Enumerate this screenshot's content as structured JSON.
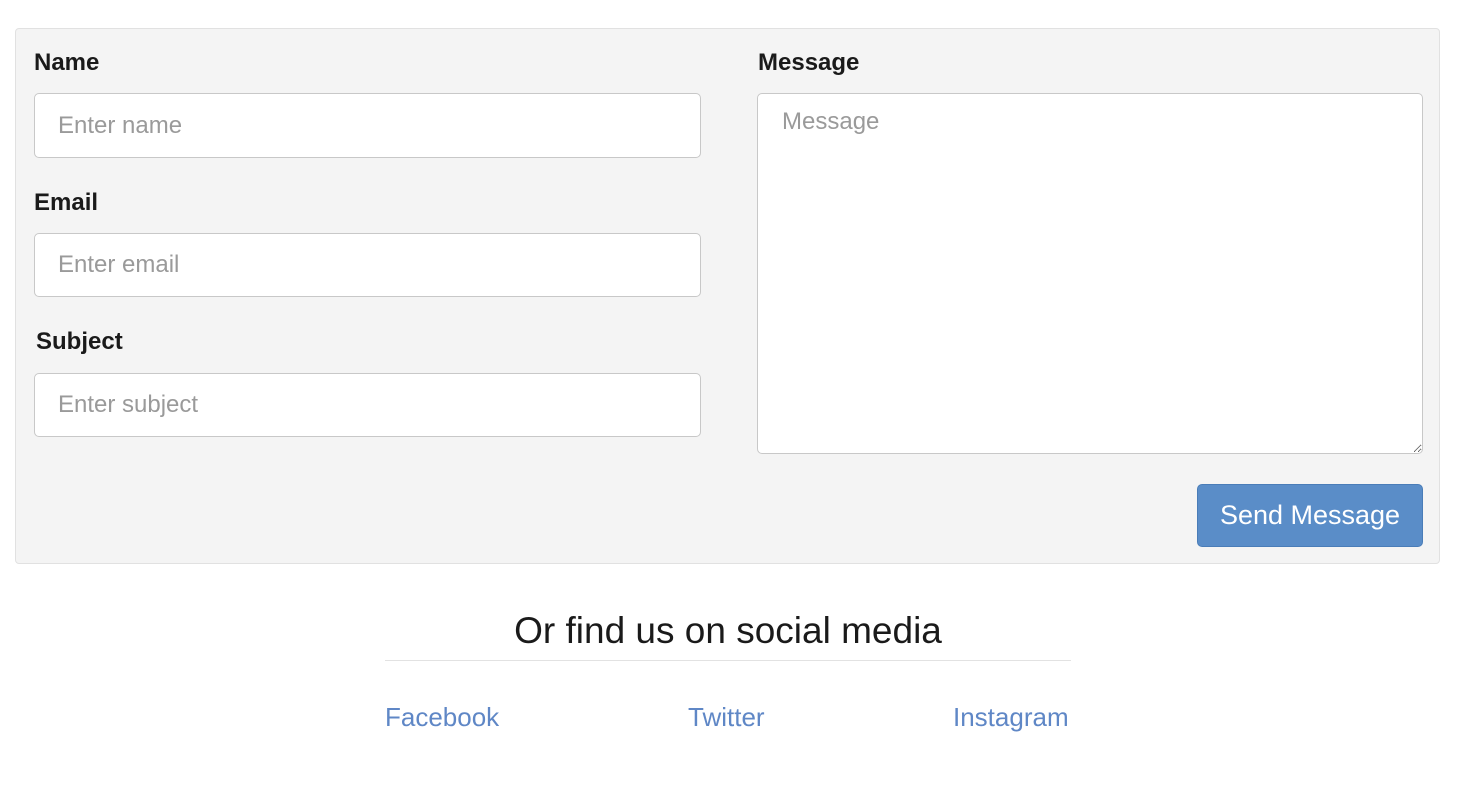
{
  "form": {
    "name": {
      "label": "Name",
      "placeholder": "Enter name"
    },
    "email": {
      "label": "Email",
      "placeholder": "Enter email"
    },
    "subject": {
      "label": "Subject",
      "placeholder": "Enter subject"
    },
    "message": {
      "label": "Message",
      "placeholder": "Message"
    },
    "submit_label": "Send Message"
  },
  "social": {
    "heading": "Or find us on social media",
    "links": [
      {
        "label": "Facebook"
      },
      {
        "label": "Twitter"
      },
      {
        "label": "Instagram"
      }
    ]
  },
  "colors": {
    "panel_background": "#f4f4f4",
    "button_background": "#5a8dc8",
    "link": "#5f87c6"
  }
}
